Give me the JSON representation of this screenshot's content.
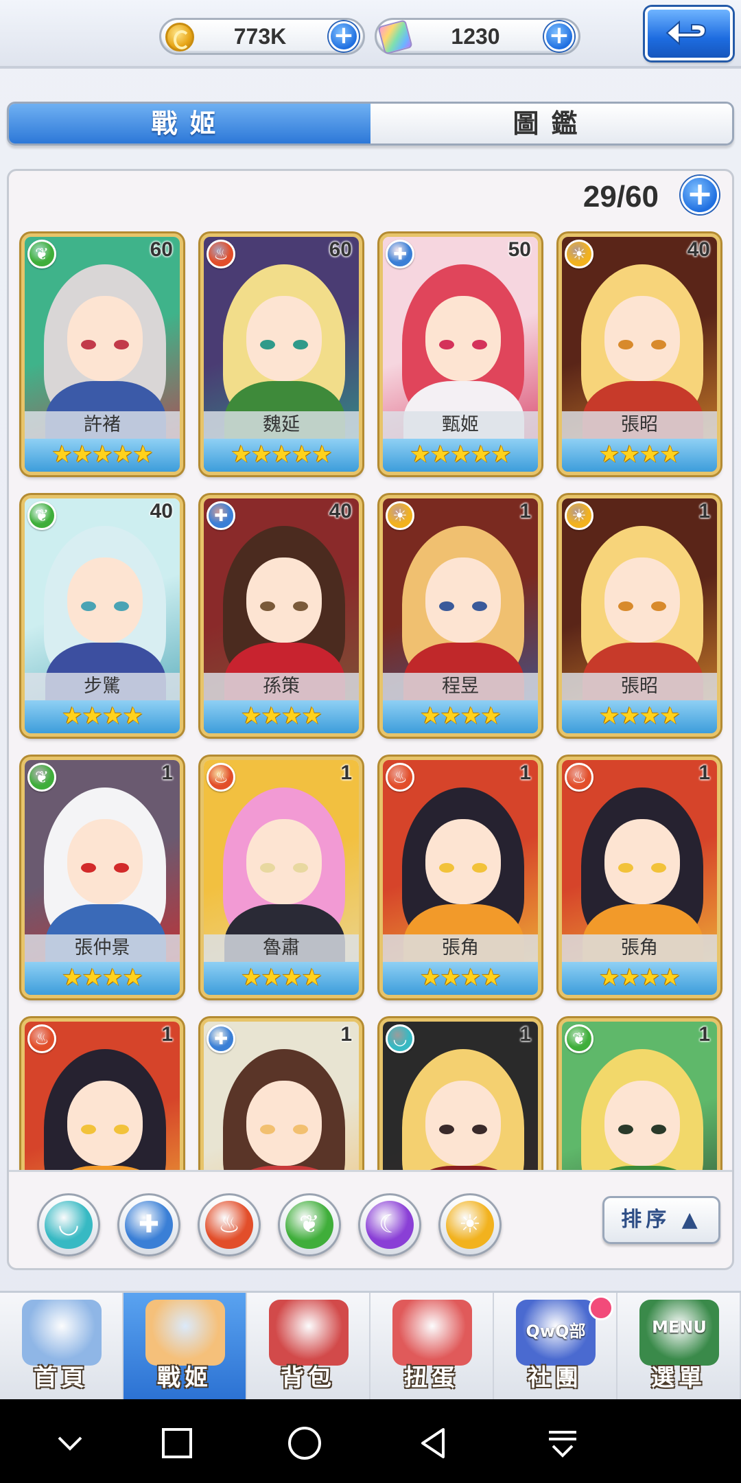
{
  "currencies": {
    "gold": {
      "value": "773K",
      "icon": "coin-icon"
    },
    "gems": {
      "value": "1230",
      "icon": "gem-icon"
    }
  },
  "tabs": [
    {
      "label": "戰姬",
      "active": true
    },
    {
      "label": "圖鑑",
      "active": false
    }
  ],
  "roster": {
    "count": "29/60"
  },
  "cards": [
    {
      "name": "許褚",
      "level": "60",
      "element": "leaf",
      "stars": "★★★★★",
      "palette": [
        "#3fb38a",
        "#d9d6d6",
        "#3b5aa8",
        "#c23a4a"
      ]
    },
    {
      "name": "魏延",
      "level": "60",
      "element": "flame",
      "stars": "★★★★★",
      "palette": [
        "#4a3c73",
        "#f2dd8a",
        "#3e8a3a",
        "#2f9a8a"
      ]
    },
    {
      "name": "甄姬",
      "level": "50",
      "element": "shield",
      "stars": "★★★★★",
      "palette": [
        "#f6d6df",
        "#e0455b",
        "#f4f0f4",
        "#d4325a"
      ]
    },
    {
      "name": "張昭",
      "level": "40",
      "element": "sun",
      "stars": "★★★★",
      "palette": [
        "#5a2518",
        "#f7d47a",
        "#c73a2a",
        "#d88a2c"
      ]
    },
    {
      "name": "步騭",
      "level": "40",
      "element": "leaf",
      "stars": "★★★★",
      "palette": [
        "#cdeef0",
        "#d8eef2",
        "#3c4fa0",
        "#4aa3b4"
      ]
    },
    {
      "name": "孫策",
      "level": "40",
      "element": "shield",
      "stars": "★★★★",
      "palette": [
        "#8a2a2a",
        "#4b2b1f",
        "#c8232f",
        "#7a5a3a"
      ]
    },
    {
      "name": "程昱",
      "level": "1",
      "element": "sun",
      "stars": "★★★★",
      "palette": [
        "#7a2a20",
        "#f0c070",
        "#c0282a",
        "#3a5a9a"
      ]
    },
    {
      "name": "張昭",
      "level": "1",
      "element": "sun",
      "stars": "★★★★",
      "palette": [
        "#5a2518",
        "#f7d47a",
        "#c73a2a",
        "#d88a2c"
      ]
    },
    {
      "name": "張仲景",
      "level": "1",
      "element": "leaf",
      "stars": "★★★★",
      "palette": [
        "#6a5a70",
        "#f4f4f6",
        "#3a6ab8",
        "#d22a2a"
      ]
    },
    {
      "name": "魯肅",
      "level": "1",
      "element": "flame",
      "stars": "★★★★",
      "palette": [
        "#f2c040",
        "#f29ad4",
        "#2a2a36",
        "#e8d8a0"
      ]
    },
    {
      "name": "張角",
      "level": "1",
      "element": "flame",
      "stars": "★★★★",
      "palette": [
        "#d6442a",
        "#262230",
        "#f29a2a",
        "#f2c23a"
      ]
    },
    {
      "name": "張角",
      "level": "1",
      "element": "flame",
      "stars": "★★★★",
      "palette": [
        "#d6442a",
        "#262230",
        "#f29a2a",
        "#f2c23a"
      ]
    },
    {
      "name": "",
      "level": "1",
      "element": "flame",
      "stars": "",
      "palette": [
        "#d6442a",
        "#262230",
        "#f29a2a",
        "#f2c23a"
      ]
    },
    {
      "name": "",
      "level": "1",
      "element": "shield",
      "stars": "",
      "palette": [
        "#e8e4d2",
        "#5a3528",
        "#c83a3a",
        "#f2c070"
      ]
    },
    {
      "name": "",
      "level": "1",
      "element": "ghost",
      "stars": "",
      "palette": [
        "#2a2a2a",
        "#f4d070",
        "#8a1e20",
        "#3a2a2a"
      ]
    },
    {
      "name": "",
      "level": "1",
      "element": "leaf",
      "stars": "",
      "palette": [
        "#5fb86a",
        "#f2d86a",
        "#3a8a3a",
        "#2a3a2a"
      ]
    }
  ],
  "element_filters": [
    {
      "name": "ghost",
      "symbol": "◡",
      "color": "#37b9c3"
    },
    {
      "name": "shield",
      "symbol": "✚",
      "color": "#3a7fd6"
    },
    {
      "name": "flame",
      "symbol": "♨",
      "color": "#e24e2a"
    },
    {
      "name": "leaf",
      "symbol": "❦",
      "color": "#3fae3a"
    },
    {
      "name": "moon",
      "symbol": "☾",
      "color": "#8a3fd6"
    },
    {
      "name": "sun",
      "symbol": "☀",
      "color": "#f2b21e"
    }
  ],
  "sort": {
    "label": "排序 ▲"
  },
  "bottom_nav": [
    {
      "label": "首頁",
      "active": false,
      "art": "castle",
      "badge": false,
      "color": "#8fb6e6"
    },
    {
      "label": "戰姬",
      "active": true,
      "art": "girl",
      "badge": false,
      "color": "#f5c07a"
    },
    {
      "label": "背包",
      "active": false,
      "art": "backpack",
      "badge": false,
      "color": "#d24a4a"
    },
    {
      "label": "扭蛋",
      "active": false,
      "art": "gacha",
      "badge": false,
      "color": "#e05a5a"
    },
    {
      "label": "社團",
      "active": false,
      "art": "club",
      "badge": true,
      "color": "#4a6ad0",
      "sign": "QwQ部"
    },
    {
      "label": "選單",
      "active": false,
      "art": "menu-book",
      "badge": false,
      "color": "#3a8a4a",
      "sign": "MENU"
    }
  ]
}
